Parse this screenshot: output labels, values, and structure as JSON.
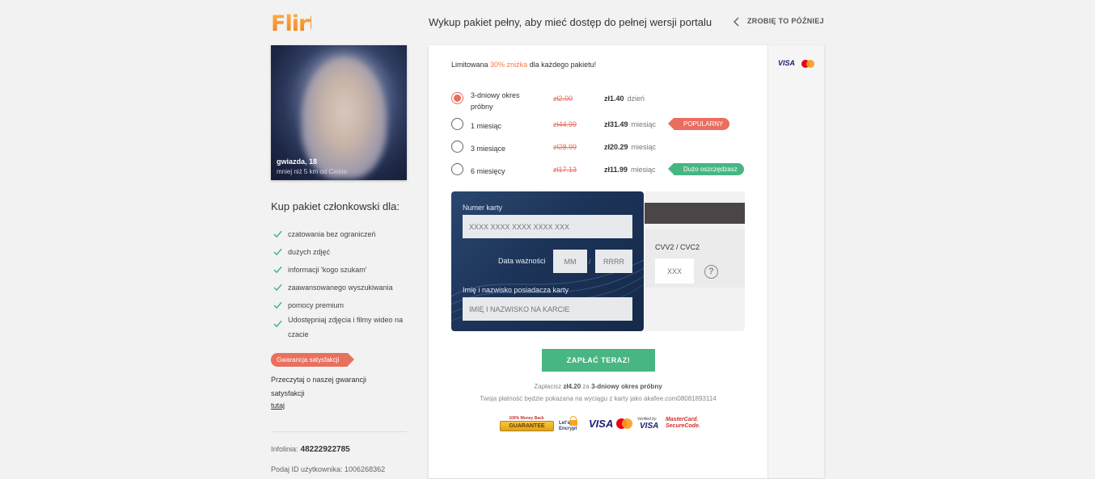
{
  "brand": {
    "logo_text": "Flirt"
  },
  "profile": {
    "name": "gwiazda, 18",
    "distance": "mniej niż 5 km od Ciebie"
  },
  "sidebar": {
    "heading": "Kup pakiet członkowski dla:",
    "features": [
      "czatowania bez ograniczeń",
      "dużych zdjęć",
      "informacji 'kogo szukam'",
      "zaawansowanego wyszukiwania",
      "pomocy premium",
      "Udostępniaj zdjęcia i filmy wideo na czacie"
    ],
    "guarantee_badge": "Gwarancja satysfakcji",
    "guarantee_text": "Przeczytaj o naszej gwarancji satysfakcji",
    "guarantee_link": "tutaj",
    "hotline_label": "Infolinia:",
    "hotline_number": "48222922785",
    "user_id": "Podaj ID użytkownika: 1006268362"
  },
  "header": {
    "headline": "Wykup pakiet pełny, aby mieć dostęp do pełnej wersji portalu",
    "later": "ZROBIĘ TO PÓŹNIEJ"
  },
  "promo": {
    "prefix": "Limitowana",
    "discount": "30% zniżka",
    "suffix": "dla każdego pakietu!"
  },
  "plans": [
    {
      "name": "3-dniowy okres próbny",
      "old_price": "zł2.00",
      "price": "zł1.40",
      "unit": "dzień",
      "selected": true,
      "tag": ""
    },
    {
      "name": "1 miesiąc",
      "old_price": "zł44.99",
      "price": "zł31.49",
      "unit": "miesiąc",
      "selected": false,
      "tag": "POPULARNY"
    },
    {
      "name": "3 miesiące",
      "old_price": "zł28.99",
      "price": "zł20.29",
      "unit": "miesiąc",
      "selected": false,
      "tag": ""
    },
    {
      "name": "6 miesięcy",
      "old_price": "zł17.13",
      "price": "zł11.99",
      "unit": "miesiąc",
      "selected": false,
      "tag": "Dużo oszczędzasz"
    }
  ],
  "card_form": {
    "number_label": "Numer karty",
    "number_placeholder": "XXXX XXXX XXXX XXXX XXX",
    "expiry_label": "Data ważności",
    "month_placeholder": "MM",
    "year_placeholder": "RRRR",
    "slash": "/",
    "holder_label": "Imię i nazwisko posiadacza karty",
    "holder_placeholder": "IMIĘ I NAZWISKO NA KARCIE",
    "cvv_label": "CVV2 / CVC2",
    "cvv_placeholder": "XXX",
    "help_glyph": "?"
  },
  "pay": {
    "button": "ZAPŁAĆ TERAZ!",
    "summary_prefix": "Zapłacisz",
    "summary_amount": "zł4.20",
    "summary_middle": "za",
    "summary_plan": "3-dniowy okres próbny",
    "statement": "Twoja płatność będzie pokazana na wyciągu z karty jako akafee.com08081893114"
  },
  "trust": {
    "mb_top": "100% Money Back",
    "mb_ribbon": "GUARANTEE",
    "le": "Let's Encrypt",
    "visa": "VISA",
    "vbv_small": "Verified by",
    "vbv_big": "VISA",
    "mcsc_a": "MasterCard.",
    "mcsc_b": "SecureCode."
  },
  "accepted_cards": {
    "visa": "VISA"
  },
  "colors": {
    "accent_red": "#e8705f",
    "accent_green": "#47b682",
    "card_navy": "#1c3358",
    "discount_orange": "#f07c4a"
  },
  "icons": {
    "check": "check-icon",
    "back": "chevron-left-icon",
    "help": "help-circle-icon",
    "mastercard": "mastercard-icon",
    "lock": "lock-icon"
  }
}
